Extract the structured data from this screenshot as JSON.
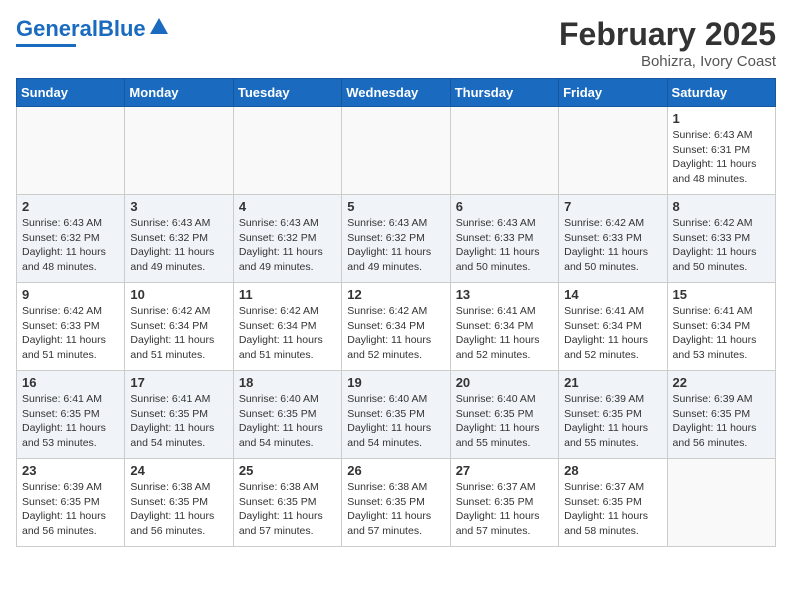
{
  "header": {
    "logo_general": "General",
    "logo_blue": "Blue",
    "month_title": "February 2025",
    "location": "Bohizra, Ivory Coast"
  },
  "calendar": {
    "days_of_week": [
      "Sunday",
      "Monday",
      "Tuesday",
      "Wednesday",
      "Thursday",
      "Friday",
      "Saturday"
    ],
    "weeks": [
      [
        {
          "day": "",
          "info": ""
        },
        {
          "day": "",
          "info": ""
        },
        {
          "day": "",
          "info": ""
        },
        {
          "day": "",
          "info": ""
        },
        {
          "day": "",
          "info": ""
        },
        {
          "day": "",
          "info": ""
        },
        {
          "day": "1",
          "info": "Sunrise: 6:43 AM\nSunset: 6:31 PM\nDaylight: 11 hours and 48 minutes."
        }
      ],
      [
        {
          "day": "2",
          "info": "Sunrise: 6:43 AM\nSunset: 6:32 PM\nDaylight: 11 hours and 48 minutes."
        },
        {
          "day": "3",
          "info": "Sunrise: 6:43 AM\nSunset: 6:32 PM\nDaylight: 11 hours and 49 minutes."
        },
        {
          "day": "4",
          "info": "Sunrise: 6:43 AM\nSunset: 6:32 PM\nDaylight: 11 hours and 49 minutes."
        },
        {
          "day": "5",
          "info": "Sunrise: 6:43 AM\nSunset: 6:32 PM\nDaylight: 11 hours and 49 minutes."
        },
        {
          "day": "6",
          "info": "Sunrise: 6:43 AM\nSunset: 6:33 PM\nDaylight: 11 hours and 50 minutes."
        },
        {
          "day": "7",
          "info": "Sunrise: 6:42 AM\nSunset: 6:33 PM\nDaylight: 11 hours and 50 minutes."
        },
        {
          "day": "8",
          "info": "Sunrise: 6:42 AM\nSunset: 6:33 PM\nDaylight: 11 hours and 50 minutes."
        }
      ],
      [
        {
          "day": "9",
          "info": "Sunrise: 6:42 AM\nSunset: 6:33 PM\nDaylight: 11 hours and 51 minutes."
        },
        {
          "day": "10",
          "info": "Sunrise: 6:42 AM\nSunset: 6:34 PM\nDaylight: 11 hours and 51 minutes."
        },
        {
          "day": "11",
          "info": "Sunrise: 6:42 AM\nSunset: 6:34 PM\nDaylight: 11 hours and 51 minutes."
        },
        {
          "day": "12",
          "info": "Sunrise: 6:42 AM\nSunset: 6:34 PM\nDaylight: 11 hours and 52 minutes."
        },
        {
          "day": "13",
          "info": "Sunrise: 6:41 AM\nSunset: 6:34 PM\nDaylight: 11 hours and 52 minutes."
        },
        {
          "day": "14",
          "info": "Sunrise: 6:41 AM\nSunset: 6:34 PM\nDaylight: 11 hours and 52 minutes."
        },
        {
          "day": "15",
          "info": "Sunrise: 6:41 AM\nSunset: 6:34 PM\nDaylight: 11 hours and 53 minutes."
        }
      ],
      [
        {
          "day": "16",
          "info": "Sunrise: 6:41 AM\nSunset: 6:35 PM\nDaylight: 11 hours and 53 minutes."
        },
        {
          "day": "17",
          "info": "Sunrise: 6:41 AM\nSunset: 6:35 PM\nDaylight: 11 hours and 54 minutes."
        },
        {
          "day": "18",
          "info": "Sunrise: 6:40 AM\nSunset: 6:35 PM\nDaylight: 11 hours and 54 minutes."
        },
        {
          "day": "19",
          "info": "Sunrise: 6:40 AM\nSunset: 6:35 PM\nDaylight: 11 hours and 54 minutes."
        },
        {
          "day": "20",
          "info": "Sunrise: 6:40 AM\nSunset: 6:35 PM\nDaylight: 11 hours and 55 minutes."
        },
        {
          "day": "21",
          "info": "Sunrise: 6:39 AM\nSunset: 6:35 PM\nDaylight: 11 hours and 55 minutes."
        },
        {
          "day": "22",
          "info": "Sunrise: 6:39 AM\nSunset: 6:35 PM\nDaylight: 11 hours and 56 minutes."
        }
      ],
      [
        {
          "day": "23",
          "info": "Sunrise: 6:39 AM\nSunset: 6:35 PM\nDaylight: 11 hours and 56 minutes."
        },
        {
          "day": "24",
          "info": "Sunrise: 6:38 AM\nSunset: 6:35 PM\nDaylight: 11 hours and 56 minutes."
        },
        {
          "day": "25",
          "info": "Sunrise: 6:38 AM\nSunset: 6:35 PM\nDaylight: 11 hours and 57 minutes."
        },
        {
          "day": "26",
          "info": "Sunrise: 6:38 AM\nSunset: 6:35 PM\nDaylight: 11 hours and 57 minutes."
        },
        {
          "day": "27",
          "info": "Sunrise: 6:37 AM\nSunset: 6:35 PM\nDaylight: 11 hours and 57 minutes."
        },
        {
          "day": "28",
          "info": "Sunrise: 6:37 AM\nSunset: 6:35 PM\nDaylight: 11 hours and 58 minutes."
        },
        {
          "day": "",
          "info": ""
        }
      ]
    ]
  }
}
